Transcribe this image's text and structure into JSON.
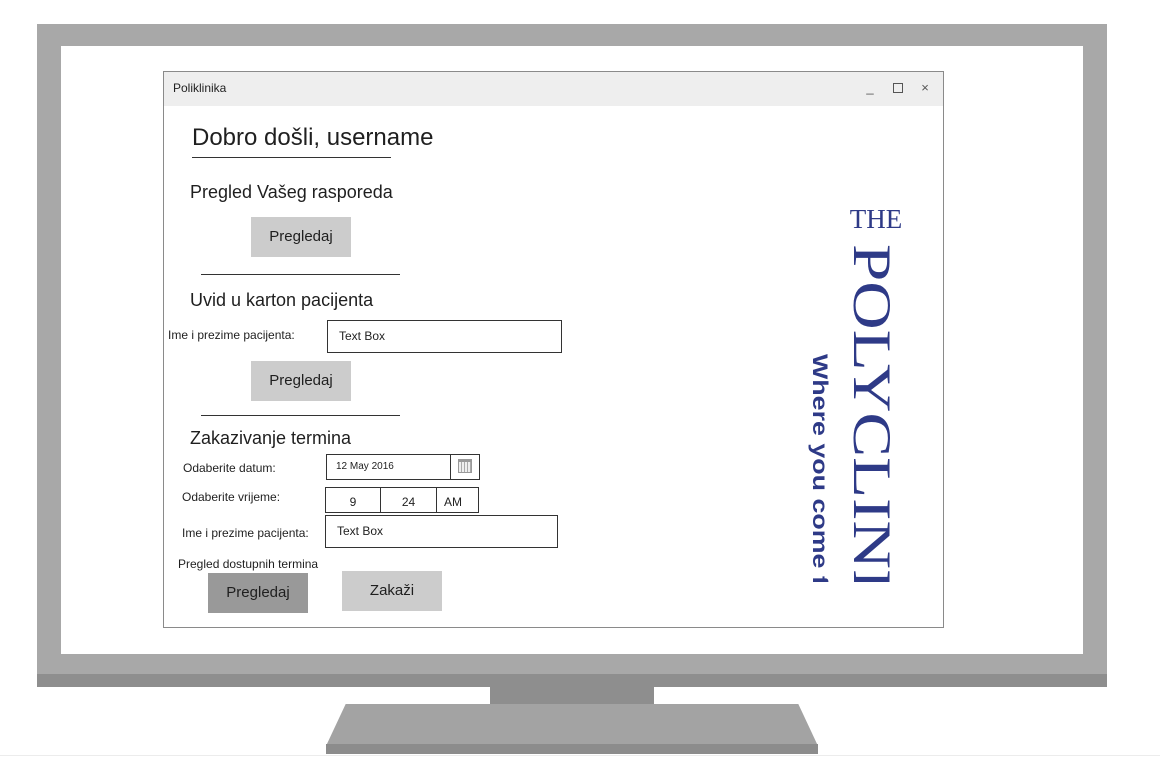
{
  "window": {
    "title": "Poliklinika",
    "minimize_glyph": "_",
    "close_glyph": "×"
  },
  "welcome": {
    "title": "Dobro došli, username"
  },
  "schedule_section": {
    "heading": "Pregled Vašeg rasporeda",
    "button_label": "Pregledaj"
  },
  "chart_section": {
    "heading": "Uvid u karton pacijenta",
    "patient_label": "Ime i prezime pacijenta:",
    "patient_value": "Text Box",
    "button_label": "Pregledaj"
  },
  "booking_section": {
    "heading": "Zakazivanje termina",
    "date_label": "Odaberite datum:",
    "date_value": "12 May 2016",
    "time_label": "Odaberite vrijeme:",
    "time_hour": "9",
    "time_minute": "24",
    "time_ampm": "AM",
    "patient_label": "Ime i prezime pacijenta:",
    "patient_value": "Text Box",
    "available_label": "Pregled dostupnih termina",
    "available_button_label": "Pregledaj",
    "book_button_label": "Zakaži"
  },
  "logo": {
    "line1": "THE",
    "line2": "POLYCLINIC",
    "tagline": "Where you come first.",
    "color": "#2e3a87"
  },
  "icons": {
    "calendar": "calendar-icon",
    "minimize": "minimize-icon",
    "maximize": "maximize-icon",
    "close": "close-icon"
  }
}
